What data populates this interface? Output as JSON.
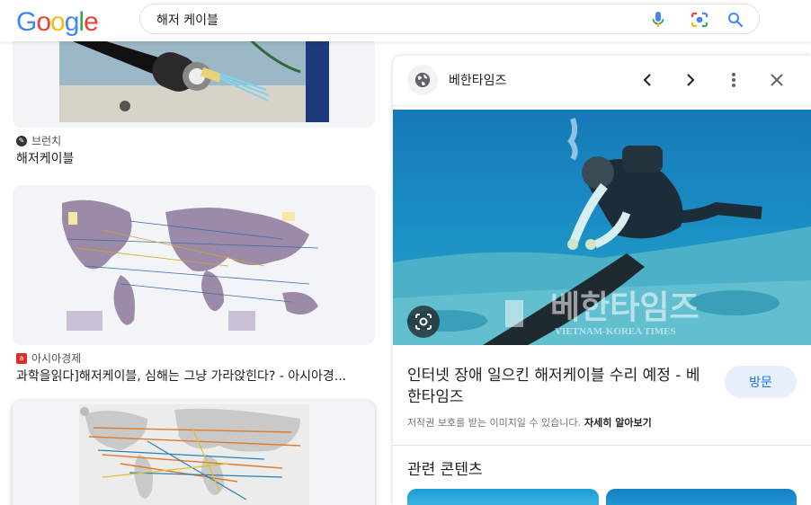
{
  "header": {
    "logo_letters": [
      "G",
      "o",
      "o",
      "g",
      "l",
      "e"
    ],
    "logo_colors": [
      "#4285F4",
      "#EA4335",
      "#FBBC05",
      "#4285F4",
      "#34A853",
      "#EA4335"
    ],
    "search_query": "해저 케이블",
    "icons": {
      "voice": "microphone-icon",
      "lens": "camera-icon",
      "search": "search-icon"
    }
  },
  "results": [
    {
      "source": "브런치",
      "title": "해저케이블",
      "favicon_color": "#333333"
    },
    {
      "source": "아시아경제",
      "title": "과학을읽다]해저케이블, 심해는 그냥 가라앉힌다? - 아시아경...",
      "favicon_color": "#d93025"
    }
  ],
  "panel": {
    "site_name": "베한타임즈",
    "icons": {
      "globe": "globe-icon",
      "prev": "chevron-left-icon",
      "next": "chevron-right-icon",
      "more": "more-vert-icon",
      "close": "close-icon",
      "lens": "lens-icon"
    },
    "watermark_ko": "베한타임즈",
    "watermark_en": "VIETNAM-KOREA TIMES",
    "title": "인터넷 장애 일으킨 해저케이블 수리 예정 - 베한타임즈",
    "visit_label": "방문",
    "copyright_text": "저작권 보호를 받는 이미지일 수 있습니다.",
    "learn_more": "자세히 알아보기",
    "related_heading": "관련 콘텐츠"
  },
  "colors": {
    "accent": "#1a73e8",
    "visit_bg": "#e8f0fe"
  }
}
